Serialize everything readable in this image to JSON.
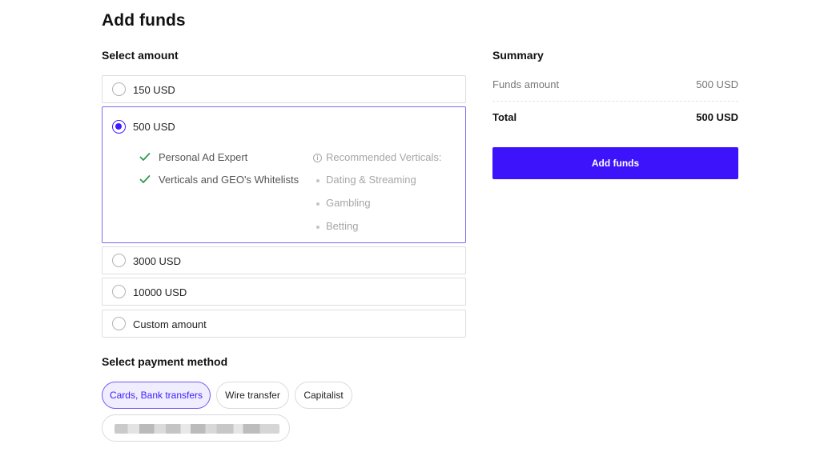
{
  "page": {
    "title": "Add funds"
  },
  "amount": {
    "section_title": "Select amount",
    "options": [
      {
        "label": "150 USD",
        "selected": false
      },
      {
        "label": "500 USD",
        "selected": true
      },
      {
        "label": "3000 USD",
        "selected": false
      },
      {
        "label": "10000 USD",
        "selected": false
      },
      {
        "label": "Custom amount",
        "selected": false
      }
    ],
    "selected_details": {
      "features": [
        "Personal Ad Expert",
        "Verticals and GEO's Whitelists"
      ],
      "recommended_heading": "Recommended Verticals:",
      "recommended": [
        "Dating & Streaming",
        "Gambling",
        "Betting"
      ]
    }
  },
  "payment": {
    "section_title": "Select payment method",
    "methods": [
      {
        "label": "Cards, Bank transfers",
        "active": true
      },
      {
        "label": "Wire transfer",
        "active": false
      },
      {
        "label": "Capitalist",
        "active": false
      }
    ]
  },
  "summary": {
    "title": "Summary",
    "funds_amount_label": "Funds amount",
    "funds_amount_value": "500 USD",
    "total_label": "Total",
    "total_value": "500 USD",
    "button_label": "Add funds"
  },
  "colors": {
    "accent": "#3d13fb",
    "selected_border": "#7b6cf0",
    "check_green": "#2e9b4e"
  },
  "icons": {
    "check": "check-icon",
    "info": "info-icon",
    "radio": "radio-icon"
  }
}
